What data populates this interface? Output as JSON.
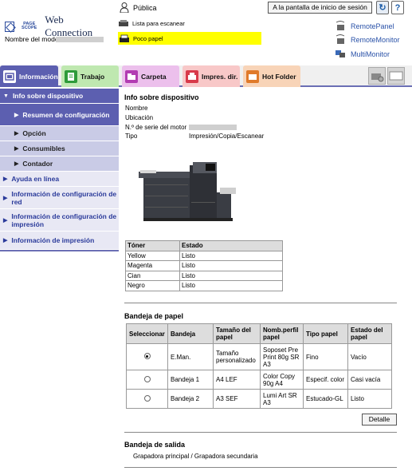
{
  "header": {
    "logo_small": "PAGE SCOPE",
    "logo_title": "Web Connection",
    "model_label": "Nombre del modelo",
    "user_label": "Pública",
    "home_button": "A la pantalla de inicio de sesión",
    "refresh_label": "↻",
    "help_label": "?",
    "scan_label": "Lista para escanear",
    "paper_label": "Poco papel",
    "remote_links": [
      "RemotePanel",
      "RemoteMonitor",
      "MultiMonitor"
    ],
    "paper_highlight_color": "#ffff00"
  },
  "tabs": [
    {
      "label": "Información",
      "color": "#5c5fb0"
    },
    {
      "label": "Trabajo",
      "color": "#bfe8b0"
    },
    {
      "label": "Carpeta",
      "color": "#ecc0ec"
    },
    {
      "label": "Impres. dir.",
      "color": "#f8c8c8"
    },
    {
      "label": "Hot Folder",
      "color": "#f8d4b8"
    }
  ],
  "sidebar": {
    "top": "Info sobre dispositivo",
    "subitems": [
      "Resumen de configuración",
      "Opción",
      "Consumibles",
      "Contador"
    ],
    "items": [
      "Ayuda en línea",
      "Información de configuración de red",
      "Información de configuración de impresión",
      "Información de impresión"
    ]
  },
  "device_info": {
    "title": "Info sobre dispositivo",
    "name_label": "Nombre",
    "location_label": "Ubicación",
    "serial_label": "N.º de serie del motor",
    "type_label": "Tipo",
    "type_value": "Impresión/Copia/Escanear"
  },
  "toner": {
    "headers": [
      "Tóner",
      "Estado"
    ],
    "rows": [
      [
        "Yellow",
        "Listo"
      ],
      [
        "Magenta",
        "Listo"
      ],
      [
        "Cian",
        "Listo"
      ],
      [
        "Negro",
        "Listo"
      ]
    ]
  },
  "paper_tray": {
    "title": "Bandeja de papel",
    "headers": [
      "Seleccionar",
      "Bandeja",
      "Tamaño del papel",
      "Nomb.perfil papel",
      "Tipo papel",
      "Estado del papel"
    ],
    "rows": [
      {
        "selected": true,
        "tray": "E.Man.",
        "size": "Tamaño personalizado",
        "profile": "Soposet Pre Print 80g SR A3",
        "type": "Fino",
        "status": "Vacío"
      },
      {
        "selected": false,
        "tray": "Bandeja 1",
        "size": "A4 LEF",
        "profile": "Color Copy 90g A4",
        "type": "Especif. color",
        "status": "Casi vacía"
      },
      {
        "selected": false,
        "tray": "Bandeja 2",
        "size": "A3 SEF",
        "profile": "Lumi Art SR A3",
        "type": "Estucado-GL",
        "status": "Listo"
      }
    ],
    "detail_button": "Detalle"
  },
  "output_tray": {
    "title": "Bandeja de salida",
    "value": "Grapadora principal / Grapadora secundaria"
  }
}
